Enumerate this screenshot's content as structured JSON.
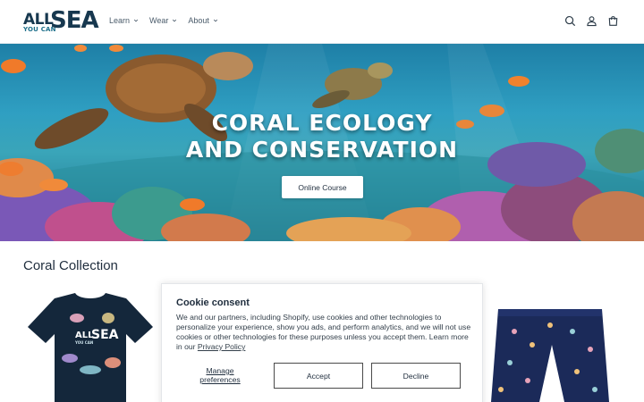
{
  "brand": {
    "logo_line1": "ALL",
    "logo_line2": "YOU CAN",
    "logo_line3": "SEA",
    "colors": {
      "navy": "#17384f",
      "teal": "#1d6f8a"
    }
  },
  "nav": {
    "items": [
      {
        "label": "Learn",
        "icon": "chevron-down-icon"
      },
      {
        "label": "Wear",
        "icon": "chevron-down-icon"
      },
      {
        "label": "About",
        "icon": "chevron-down-icon"
      }
    ],
    "icons": [
      "search-icon",
      "account-icon",
      "cart-icon"
    ]
  },
  "hero": {
    "title_line1": "CORAL ECOLOGY",
    "title_line2": "AND CONSERVATION",
    "button_label": "Online Course"
  },
  "collection": {
    "title": "Coral Collection",
    "tshirt_logo_line1": "ALL",
    "tshirt_logo_line2": "YOU CAN",
    "tshirt_logo_line3": "SEA"
  },
  "cookie": {
    "title": "Cookie consent",
    "text": "We and our partners, including Shopify, use cookies and other technologies to personalize your experience, show you ads, and perform analytics, and we will not use cookies or other technologies for these purposes unless you accept them. Learn more in our ",
    "policy_link": "Privacy Policy",
    "manage_label": "Manage preferences",
    "accept_label": "Accept",
    "decline_label": "Decline"
  }
}
